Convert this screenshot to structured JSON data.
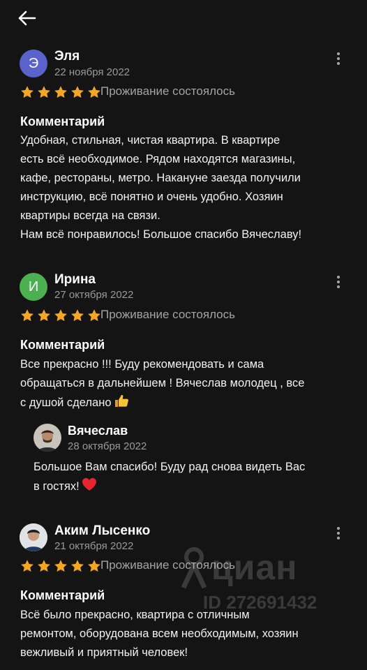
{
  "header": {
    "back_icon": "arrow-left-icon"
  },
  "reviews": [
    {
      "author": "Эля",
      "avatar_letter": "Э",
      "avatar_color": "#5a63cc",
      "date": "22 ноября 2022",
      "rating": 5,
      "status": "Проживание состоялось",
      "comment_title": "Комментарий",
      "comment_lines": [
        "Удобная, стильная, чистая квартира. В квартире",
        "есть всё необходимое. Рядом находятся магазины,",
        "кафе, рестораны, метро.  Накануне заезда получили",
        "инструкцию, всё понятно и очень удобно. Хозяин",
        "квартиры всегда на связи.",
        "Нам всё понравилось! Большое спасибо Вячеславу!"
      ]
    },
    {
      "author": "Ирина",
      "avatar_letter": "И",
      "avatar_color": "#4caf50",
      "date": "27 октября 2022",
      "rating": 5,
      "status": "Проживание состоялось",
      "comment_title": "Комментарий",
      "comment_lines": [
        "Все прекрасно !!! Буду рекомендовать и сама",
        "обращаться в дальнейшем ! Вячеслав молодец , все",
        "с душой сделано"
      ],
      "comment_emoji": "thumbs-up-icon",
      "reply": {
        "author": "Вячеслав",
        "date": "28 октября 2022",
        "lines": [
          "Большое Вам спасибо! Буду рад снова видеть Вас",
          "в гостях!"
        ],
        "emoji": "red-heart-icon"
      }
    },
    {
      "author": "Аким Лысенко",
      "date": "21 октября 2022",
      "rating": 5,
      "status": "Проживание состоялось",
      "comment_title": "Комментарий",
      "comment_lines": [
        "Всё было прекрасно, квартира с отличным",
        "ремонтом, оборудована всем необходимым, хозяин",
        "вежливый и приятный человек!"
      ]
    }
  ],
  "colors": {
    "background": "#141414",
    "star": "#f5a623",
    "muted_text": "#9a9a9a"
  },
  "watermark": {
    "brand": "циан",
    "id": "ID 272691432"
  }
}
